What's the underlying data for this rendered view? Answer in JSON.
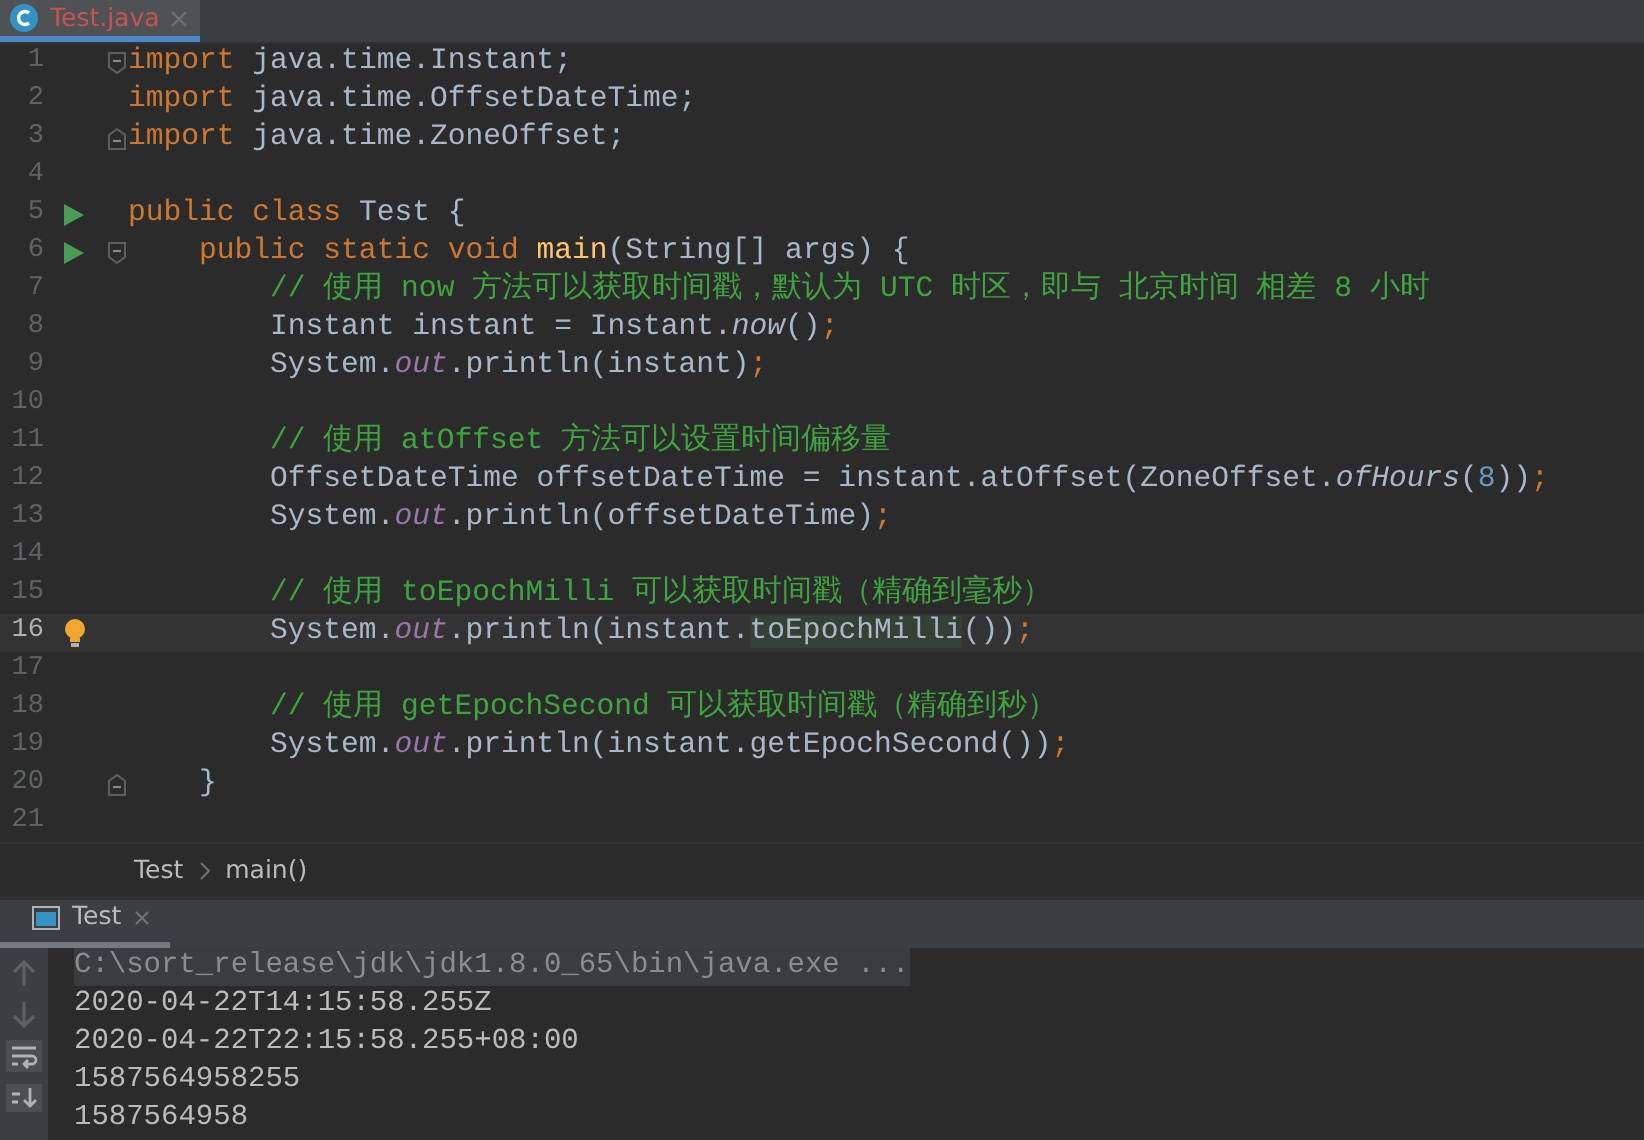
{
  "editor_tabs": [
    {
      "label": "Test.java",
      "selected": true
    }
  ],
  "code_lines": [
    {
      "number": "1",
      "current": false,
      "run_icon": false,
      "bulb": false,
      "fold_start": true,
      "fold_end": false,
      "tokens": [
        {
          "kind": "keyword",
          "text": "import"
        },
        {
          "kind": "plain",
          "text": " java.time.Instant;"
        }
      ]
    },
    {
      "number": "2",
      "current": false,
      "run_icon": false,
      "bulb": false,
      "fold_start": false,
      "fold_end": false,
      "tokens": [
        {
          "kind": "keyword",
          "text": "import"
        },
        {
          "kind": "plain",
          "text": " java.time.OffsetDateTime;"
        }
      ]
    },
    {
      "number": "3",
      "current": false,
      "run_icon": false,
      "bulb": false,
      "fold_start": false,
      "fold_end": true,
      "tokens": [
        {
          "kind": "keyword",
          "text": "import"
        },
        {
          "kind": "plain",
          "text": " java.time.ZoneOffset;"
        }
      ]
    },
    {
      "number": "4",
      "current": false,
      "run_icon": false,
      "bulb": false,
      "fold_start": false,
      "fold_end": false
    },
    {
      "number": "5",
      "current": false,
      "run_icon": true,
      "bulb": false,
      "fold_start": false,
      "fold_end": false,
      "tokens": [
        {
          "kind": "keyword",
          "text": "public class "
        },
        {
          "kind": "plain",
          "text": "Test {"
        }
      ]
    },
    {
      "number": "6",
      "current": false,
      "run_icon": true,
      "bulb": false,
      "fold_start": true,
      "fold_end": false,
      "tokens": [
        {
          "kind": "keyword",
          "text": "    public static void "
        },
        {
          "kind": "method",
          "text": "main"
        },
        {
          "kind": "plain",
          "text": "(String[] args) {"
        }
      ]
    },
    {
      "number": "7",
      "current": false,
      "run_icon": false,
      "bulb": false,
      "fold_start": false,
      "fold_end": false,
      "tokens": [
        {
          "kind": "comment",
          "text": "        // 使用 now 方法可以获取时间戳，默认为 UTC 时区，即与 北京时间 相差 8 小时"
        }
      ]
    },
    {
      "number": "8",
      "current": false,
      "run_icon": false,
      "bulb": false,
      "fold_start": false,
      "fold_end": false,
      "tokens": [
        {
          "kind": "plain",
          "text": "        Instant instant = Instant."
        },
        {
          "kind": "static_call",
          "text": "now"
        },
        {
          "kind": "plain",
          "text": "()"
        },
        {
          "kind": "punct",
          "text": ";"
        }
      ]
    },
    {
      "number": "9",
      "current": false,
      "run_icon": false,
      "bulb": false,
      "fold_start": false,
      "fold_end": false,
      "tokens": [
        {
          "kind": "plain",
          "text": "        System."
        },
        {
          "kind": "static_field",
          "text": "out"
        },
        {
          "kind": "plain",
          "text": ".println(instant)"
        },
        {
          "kind": "punct",
          "text": ";"
        }
      ]
    },
    {
      "number": "10",
      "current": false,
      "run_icon": false,
      "bulb": false,
      "fold_start": false,
      "fold_end": false
    },
    {
      "number": "11",
      "current": false,
      "run_icon": false,
      "bulb": false,
      "fold_start": false,
      "fold_end": false,
      "tokens": [
        {
          "kind": "comment",
          "text": "        // 使用 atOffset 方法可以设置时间偏移量"
        }
      ]
    },
    {
      "number": "12",
      "current": false,
      "run_icon": false,
      "bulb": false,
      "fold_start": false,
      "fold_end": false,
      "tokens": [
        {
          "kind": "plain",
          "text": "        OffsetDateTime offsetDateTime = instant.atOffset(ZoneOffset."
        },
        {
          "kind": "static_call",
          "text": "ofHours"
        },
        {
          "kind": "plain",
          "text": "("
        },
        {
          "kind": "number",
          "text": "8"
        },
        {
          "kind": "plain",
          "text": "))"
        },
        {
          "kind": "punct",
          "text": ";"
        }
      ]
    },
    {
      "number": "13",
      "current": false,
      "run_icon": false,
      "bulb": false,
      "fold_start": false,
      "fold_end": false,
      "tokens": [
        {
          "kind": "plain",
          "text": "        System."
        },
        {
          "kind": "static_field",
          "text": "out"
        },
        {
          "kind": "plain",
          "text": ".println(offsetDateTime)"
        },
        {
          "kind": "punct",
          "text": ";"
        }
      ]
    },
    {
      "number": "14",
      "current": false,
      "run_icon": false,
      "bulb": false,
      "fold_start": false,
      "fold_end": false
    },
    {
      "number": "15",
      "current": false,
      "run_icon": false,
      "bulb": false,
      "fold_start": false,
      "fold_end": false,
      "tokens": [
        {
          "kind": "comment",
          "text": "        // 使用 toEpochMilli 可以获取时间戳（精确到毫秒）"
        }
      ]
    },
    {
      "number": "16",
      "current": true,
      "run_icon": false,
      "bulb": true,
      "fold_start": false,
      "fold_end": false,
      "tokens": [
        {
          "kind": "plain",
          "text": "        System."
        },
        {
          "kind": "static_field",
          "text": "out"
        },
        {
          "kind": "plain",
          "text": ".println(instant."
        },
        {
          "kind": "usage",
          "text": "toEpochMilli"
        },
        {
          "kind": "plain",
          "text": "())"
        },
        {
          "kind": "punct",
          "text": ";"
        }
      ]
    },
    {
      "number": "17",
      "current": false,
      "run_icon": false,
      "bulb": false,
      "fold_start": false,
      "fold_end": false
    },
    {
      "number": "18",
      "current": false,
      "run_icon": false,
      "bulb": false,
      "fold_start": false,
      "fold_end": false,
      "tokens": [
        {
          "kind": "comment",
          "text": "        // 使用 getEpochSecond 可以获取时间戳（精确到秒）"
        }
      ]
    },
    {
      "number": "19",
      "current": false,
      "run_icon": false,
      "bulb": false,
      "fold_start": false,
      "fold_end": false,
      "tokens": [
        {
          "kind": "plain",
          "text": "        System."
        },
        {
          "kind": "static_field",
          "text": "out"
        },
        {
          "kind": "plain",
          "text": ".println(instant.getEpochSecond())"
        },
        {
          "kind": "punct",
          "text": ";"
        }
      ]
    },
    {
      "number": "20",
      "current": false,
      "run_icon": false,
      "bulb": false,
      "fold_start": false,
      "fold_end": true,
      "tokens": [
        {
          "kind": "plain",
          "text": "    }"
        }
      ]
    },
    {
      "number": "21",
      "current": false,
      "run_icon": false,
      "bulb": false,
      "fold_start": false,
      "fold_end": false
    }
  ],
  "breadcrumbs": [
    "Test",
    "main()"
  ],
  "run_tabs": [
    {
      "label": "Test",
      "selected": true
    }
  ],
  "console_lines": [
    {
      "kind": "command",
      "text": "C:\\sort_release\\jdk\\jdk1.8.0_65\\bin\\java.exe ..."
    },
    {
      "kind": "output",
      "text": "2020-04-22T14:15:58.255Z"
    },
    {
      "kind": "output",
      "text": "2020-04-22T22:15:58.255+08:00"
    },
    {
      "kind": "output",
      "text": "1587564958255"
    },
    {
      "kind": "output",
      "text": "1587564958"
    }
  ]
}
